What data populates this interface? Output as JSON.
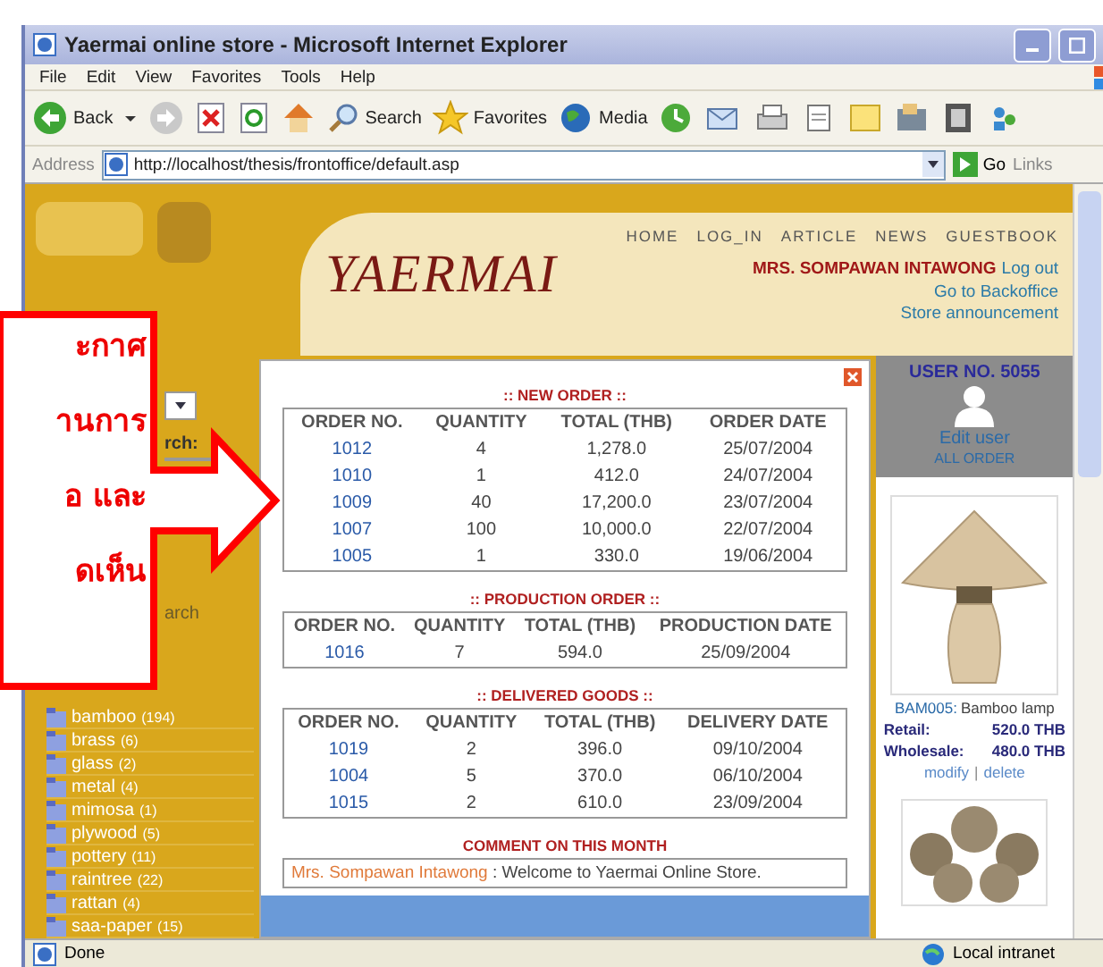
{
  "window": {
    "title": "Yaermai online store - Microsoft Internet Explorer"
  },
  "menu": [
    "File",
    "Edit",
    "View",
    "Favorites",
    "Tools",
    "Help"
  ],
  "toolbar": {
    "back": "Back",
    "search": "Search",
    "favorites": "Favorites",
    "media": "Media"
  },
  "address_bar": {
    "label": "Address",
    "url": "http://localhost/thesis/frontoffice/default.asp",
    "go": "Go",
    "links": "Links"
  },
  "header": {
    "logo": "YAERMAI",
    "nav": [
      "HOME",
      "LOG_IN",
      "ARTICLE",
      "NEWS",
      "GUESTBOOK"
    ],
    "user_name": "MRS. SOMPAWAN INTAWONG",
    "logout": "Log out",
    "backoffice": "Go to Backoffice",
    "announcement": "Store announcement"
  },
  "left": {
    "search_label": "rch:",
    "search_link": "arch",
    "categories": [
      {
        "name": "bamboo",
        "count": "(194)"
      },
      {
        "name": "brass",
        "count": "(6)"
      },
      {
        "name": "glass",
        "count": "(2)"
      },
      {
        "name": "metal",
        "count": "(4)"
      },
      {
        "name": "mimosa",
        "count": "(1)"
      },
      {
        "name": "plywood",
        "count": "(5)"
      },
      {
        "name": "pottery",
        "count": "(11)"
      },
      {
        "name": "raintree",
        "count": "(22)"
      },
      {
        "name": "rattan",
        "count": "(4)"
      },
      {
        "name": "saa-paper",
        "count": "(15)"
      }
    ]
  },
  "sections": [
    {
      "title": ":: NEW ORDER ::",
      "columns": [
        "ORDER NO.",
        "QUANTITY",
        "TOTAL (THB)",
        "ORDER DATE"
      ],
      "rows": [
        [
          "1012",
          "4",
          "1,278.0",
          "25/07/2004"
        ],
        [
          "1010",
          "1",
          "412.0",
          "24/07/2004"
        ],
        [
          "1009",
          "40",
          "17,200.0",
          "23/07/2004"
        ],
        [
          "1007",
          "100",
          "10,000.0",
          "22/07/2004"
        ],
        [
          "1005",
          "1",
          "330.0",
          "19/06/2004"
        ]
      ]
    },
    {
      "title": ":: PRODUCTION ORDER ::",
      "columns": [
        "ORDER NO.",
        "QUANTITY",
        "TOTAL (THB)",
        "PRODUCTION DATE"
      ],
      "rows": [
        [
          "1016",
          "7",
          "594.0",
          "25/09/2004"
        ]
      ]
    },
    {
      "title": ":: DELIVERED GOODS ::",
      "columns": [
        "ORDER NO.",
        "QUANTITY",
        "TOTAL (THB)",
        "DELIVERY DATE"
      ],
      "rows": [
        [
          "1019",
          "2",
          "396.0",
          "09/10/2004"
        ],
        [
          "1004",
          "5",
          "370.0",
          "06/10/2004"
        ],
        [
          "1015",
          "2",
          "610.0",
          "23/09/2004"
        ]
      ]
    }
  ],
  "comment": {
    "title": "COMMENT ON THIS MONTH",
    "author": "Mrs. Sompawan Intawong",
    "text": " : Welcome to Yaermai Online Store."
  },
  "user_panel": {
    "title": "USER NO. 5055",
    "edit": "Edit user",
    "all_orders": "ALL ORDER"
  },
  "product": {
    "code": "BAM005:",
    "name": "Bamboo lamp",
    "retail_label": "Retail:",
    "retail": "520.0 THB",
    "wholesale_label": "Wholesale:",
    "wholesale": "480.0 THB",
    "modify": "modify",
    "separator": "|",
    "delete": "delete"
  },
  "callout": {
    "lines": [
      "ะกาศ",
      "านการ",
      "อ และ",
      "ดเห็น"
    ]
  },
  "status_bar": {
    "status": "Done",
    "zone": "Local intranet"
  }
}
